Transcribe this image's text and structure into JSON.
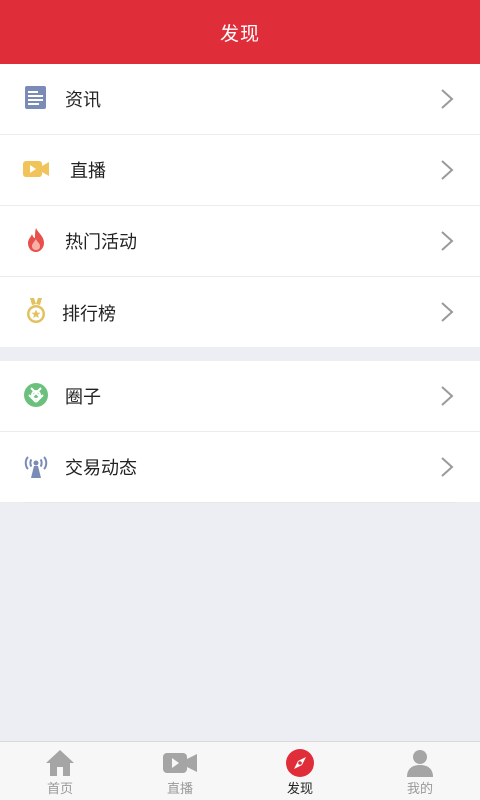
{
  "header": {
    "title": "发现"
  },
  "menu": [
    {
      "label": "资讯",
      "icon": "news-icon"
    },
    {
      "label": "直播",
      "icon": "video-camera-icon"
    },
    {
      "label": "热门活动",
      "icon": "flame-icon"
    },
    {
      "label": "排行榜",
      "icon": "medal-icon"
    },
    {
      "label": "圈子",
      "icon": "circle-aperture-icon"
    },
    {
      "label": "交易动态",
      "icon": "broadcast-antenna-icon"
    }
  ],
  "tabbar": [
    {
      "label": "首页",
      "icon": "home-icon",
      "active": false
    },
    {
      "label": "直播",
      "icon": "video-camera-icon",
      "active": false
    },
    {
      "label": "发现",
      "icon": "compass-icon",
      "active": true
    },
    {
      "label": "我的",
      "icon": "person-icon",
      "active": false
    }
  ],
  "colors": {
    "header_bg": "#e02d3a",
    "news_icon": "#7a8bb8",
    "video_icon": "#f0c45a",
    "flame_icon": "#e8504b",
    "medal_icon": "#e2c15e",
    "circle_icon": "#6cc07d",
    "antenna_icon": "#7a8bb8",
    "tab_inactive": "#999999",
    "tab_active_icon": "#e02d3a"
  }
}
